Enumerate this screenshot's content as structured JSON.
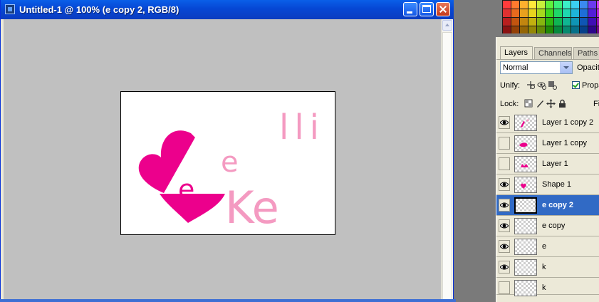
{
  "window": {
    "title": "Untitled-1 @ 100% (e copy 2, RGB/8)"
  },
  "artwork": {
    "texts": {
      "top_letters": "lli",
      "small_e": "e",
      "ke": "Ke",
      "heart_e": "e"
    },
    "colors": {
      "magenta": "#ec008c",
      "pink": "#f49ac1",
      "canvas": "#ffffff"
    }
  },
  "swatches": [
    "#ff3b3b",
    "#ff7a2e",
    "#ffb02e",
    "#ffe83b",
    "#c8f03b",
    "#5ef03b",
    "#3bf07a",
    "#3bf0c8",
    "#3bd0f0",
    "#3b8af0",
    "#6a3bf0",
    "#c83bf0",
    "#e03131",
    "#e86a1e",
    "#e8a11e",
    "#e8d41e",
    "#a8d81e",
    "#3ed81e",
    "#1ed868",
    "#1ed8b0",
    "#1eb4d8",
    "#1e6ed8",
    "#521ed8",
    "#b01ed8",
    "#b81f1f",
    "#c2540f",
    "#c2850f",
    "#c2b00f",
    "#86b50f",
    "#2eb50f",
    "#0fb552",
    "#0fb592",
    "#0f95b5",
    "#0f56b5",
    "#3e0fb5",
    "#920fb5",
    "#8a1212",
    "#944006",
    "#946506",
    "#948706",
    "#658a06",
    "#208a06",
    "#068a3d",
    "#068a6f",
    "#06718a",
    "#06408a",
    "#2c068a",
    "#6f068a"
  ],
  "layers_palette": {
    "tabs": {
      "layers": "Layers",
      "channels": "Channels",
      "paths": "Paths"
    },
    "blend_mode": "Normal",
    "opacity_label": "Opacity",
    "unify_label": "Unify:",
    "propagate_label": "Propa",
    "lock_label": "Lock:",
    "fill_label": "Fi",
    "layers": [
      {
        "name": "Layer 1 copy 2",
        "visible": true,
        "selected": false,
        "thumb": "magenta-stroke"
      },
      {
        "name": "Layer 1 copy",
        "visible": false,
        "selected": false,
        "thumb": "magenta-blob"
      },
      {
        "name": "Layer 1",
        "visible": false,
        "selected": false,
        "thumb": "magenta-crown"
      },
      {
        "name": "Shape 1",
        "visible": true,
        "selected": false,
        "thumb": "heart"
      },
      {
        "name": "e copy 2",
        "visible": true,
        "selected": true,
        "thumb": "empty"
      },
      {
        "name": "e copy",
        "visible": true,
        "selected": false,
        "thumb": "empty"
      },
      {
        "name": "e",
        "visible": true,
        "selected": false,
        "thumb": "empty"
      },
      {
        "name": "k",
        "visible": true,
        "selected": false,
        "thumb": "empty"
      },
      {
        "name": "k",
        "visible": false,
        "selected": false,
        "thumb": "empty"
      }
    ]
  }
}
